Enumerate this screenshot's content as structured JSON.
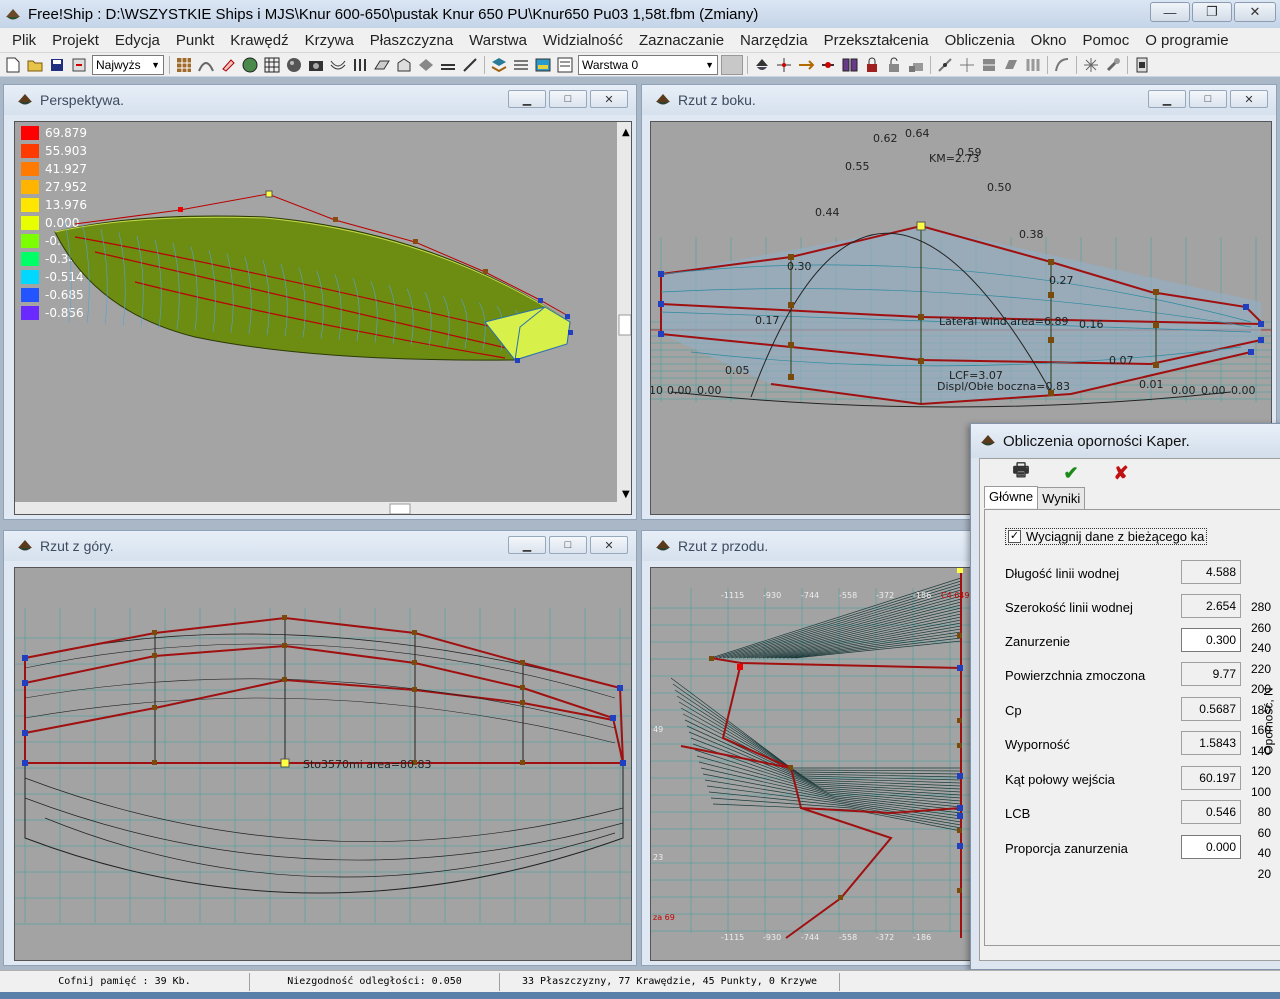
{
  "window": {
    "title": "Free!Ship  : D:\\WSZYSTKIE Ships i MJS\\Knur 600-650\\pustak Knur 650 PU\\Knur650 Pu03 1,58t.fbm (Zmiany)",
    "min": "—",
    "max": "❐",
    "close": "✕"
  },
  "menu": [
    "Plik",
    "Projekt",
    "Edycja",
    "Punkt",
    "Krawędź",
    "Krzywa",
    "Płaszczyzna",
    "Warstwa",
    "Widzialność",
    "Zaznaczanie",
    "Narzędzia",
    "Przekształcenia",
    "Obliczenia",
    "Okno",
    "Pomoc",
    "O programie"
  ],
  "toolbar": {
    "view_select": "Najwyżs",
    "layer_select": "Warstwa 0"
  },
  "windows": {
    "perspective": {
      "title": "Perspektywa.",
      "legend": [
        "69.879",
        "55.903",
        "41.927",
        "27.952",
        "13.976",
        "0.000",
        "-0.171",
        "-0.342",
        "-0.514",
        "-0.685",
        "-0.856"
      ],
      "legend_colors": [
        "#ff0000",
        "#ff3a00",
        "#ff7a00",
        "#ffb400",
        "#ffe600",
        "#e8ff00",
        "#7cff00",
        "#00ff66",
        "#00d8ff",
        "#2255ff",
        "#6a2aff"
      ]
    },
    "side": {
      "title": "Rzut z boku.",
      "labels": {
        "km": "KM=2.73",
        "lateral": "Lateral wind area=6.89",
        "lcf": "LCF=3.07",
        "displ": "Displ/Obłe boczna=0.83"
      },
      "curve_values": [
        "0.62",
        "0.64",
        "0.59",
        "0.55",
        "0.50",
        "0.44",
        "0.38",
        "0.30",
        "0.27",
        "0.17",
        "0.16",
        "0.07",
        "0.05",
        "0.01"
      ],
      "zeros_left": [
        "10",
        "0.00",
        "0.00"
      ],
      "zeros_right": [
        "0.00",
        "0.00",
        "0.00"
      ]
    },
    "top": {
      "title": "Rzut z góry.",
      "label": "Sto3570mi area=80.83"
    },
    "front": {
      "title": "Rzut z przodu.",
      "ticks_top": [
        "-1115",
        "-930",
        "-744",
        "-558",
        "-372",
        "-186"
      ],
      "ticks_bottom": [
        "-1115",
        "-930",
        "-744",
        "-558",
        "-372",
        "-186"
      ],
      "side_labels": [
        "49",
        "23",
        "za 69"
      ],
      "red_label": "C4 6499"
    }
  },
  "dialog": {
    "title": "Obliczenia oporności Kaper.",
    "tabs": [
      "Główne",
      "Wyniki"
    ],
    "toolbar": {
      "print": "🖶",
      "ok": "✔",
      "cancel": "✘"
    },
    "checkbox_label": "Wyciągnij dane z bieżącego ka",
    "checkbox_checked": "✓",
    "fields": [
      {
        "label": "Długość linii wodnej",
        "value": "4.588",
        "editable": false
      },
      {
        "label": "Szerokość linii wodnej",
        "value": "2.654",
        "editable": false
      },
      {
        "label": "Zanurzenie",
        "value": "0.300",
        "editable": true
      },
      {
        "label": "Powierzchnia zmoczona",
        "value": "9.77",
        "editable": false
      },
      {
        "label": "Cp",
        "value": "0.5687",
        "editable": false
      },
      {
        "label": "Wyporność",
        "value": "1.5843",
        "editable": false
      },
      {
        "label": "Kąt połowy wejścia",
        "value": "60.197",
        "editable": false
      },
      {
        "label": "LCB",
        "value": "0.546",
        "editable": false
      },
      {
        "label": "Proporcja zanurzenia",
        "value": "0.000",
        "editable": true
      }
    ],
    "chart_axis": {
      "ylabel": "Oporność, N",
      "ticks": [
        "280",
        "260",
        "240",
        "220",
        "200",
        "180",
        "160",
        "140",
        "120",
        "100",
        "80",
        "60",
        "40",
        "20"
      ]
    }
  },
  "status": {
    "undo": "Cofnij pamięć : 39 Kb.",
    "deviation": "Niezgodność odległości: 0.050",
    "counts": "33 Płaszczyzny, 77 Krawędzie, 45 Punkty, 0 Krzywe"
  }
}
